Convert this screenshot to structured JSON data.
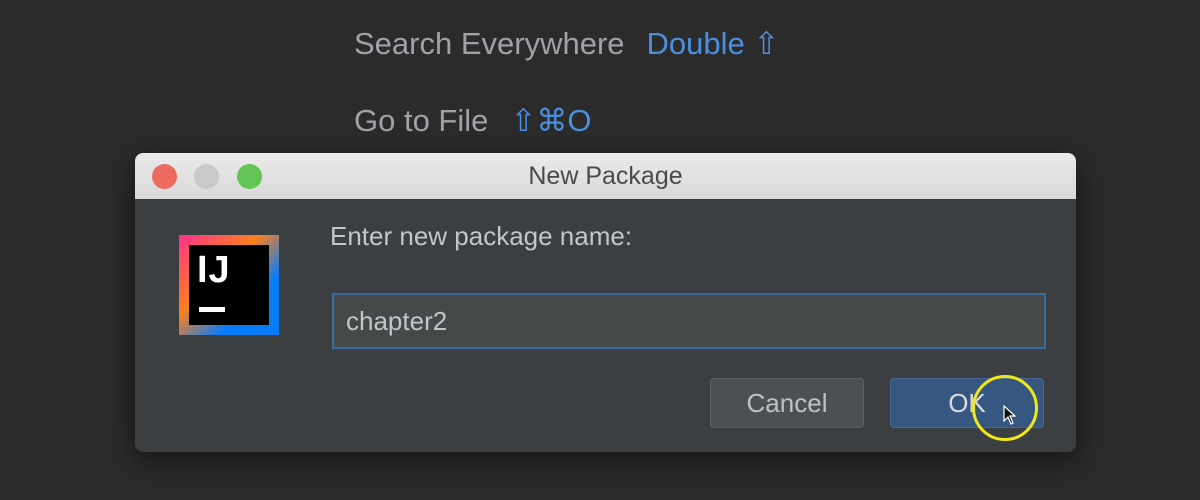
{
  "hints": [
    {
      "label": "Search Everywhere",
      "shortcut": "Double ⇧"
    },
    {
      "label": "Go to File",
      "shortcut": "⇧⌘O"
    }
  ],
  "dialog": {
    "title": "New Package",
    "logo_text": "IJ",
    "prompt": "Enter new package name:",
    "input_value": "chapter2",
    "cancel_label": "Cancel",
    "ok_label": "OK"
  },
  "colors": {
    "background": "#2b2b2c",
    "accent": "#4b8fdf",
    "dialog_bg": "#3c3f41",
    "ok_button": "#365880",
    "cursor_highlight": "#f1e51b"
  },
  "icons": [
    "intellij-logo-icon",
    "mouse-cursor-icon"
  ]
}
